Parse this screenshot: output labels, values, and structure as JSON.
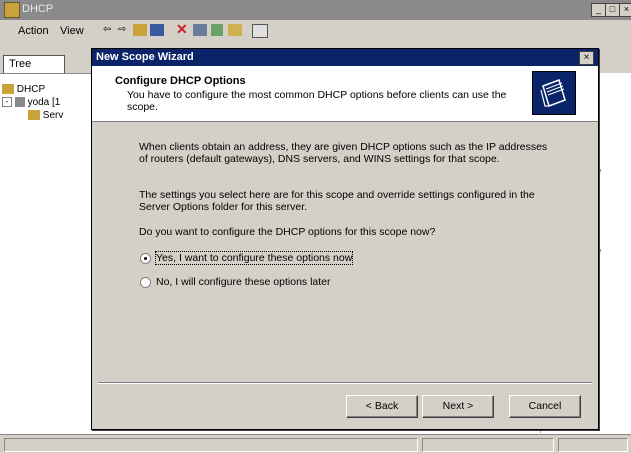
{
  "bg_window": {
    "title": "DHCP",
    "menu": {
      "action": "Action",
      "view": "View"
    },
    "tree_tab": "Tree",
    "tree": {
      "root": "DHCP",
      "server": "yoda [1",
      "child": "Serv"
    },
    "right_fragments": [
      "e",
      "e"
    ]
  },
  "wizard": {
    "title": "New Scope Wizard",
    "close": "×",
    "heading": "Configure DHCP Options",
    "subheading": "You have to configure the most common DHCP options before clients can use the scope.",
    "para1": "When clients obtain an address, they are given DHCP options such as the IP addresses of routers (default gateways), DNS servers, and WINS settings for that scope.",
    "para2": "The settings you select here are for this scope and override settings configured in the Server Options folder for this server.",
    "question": "Do you want to configure the DHCP options for this scope now?",
    "option_yes": "Yes, I want to configure these options now",
    "option_no": "No, I will configure these options later",
    "selected_option": "yes",
    "buttons": {
      "back": "< Back",
      "next": "Next >",
      "cancel": "Cancel"
    }
  }
}
